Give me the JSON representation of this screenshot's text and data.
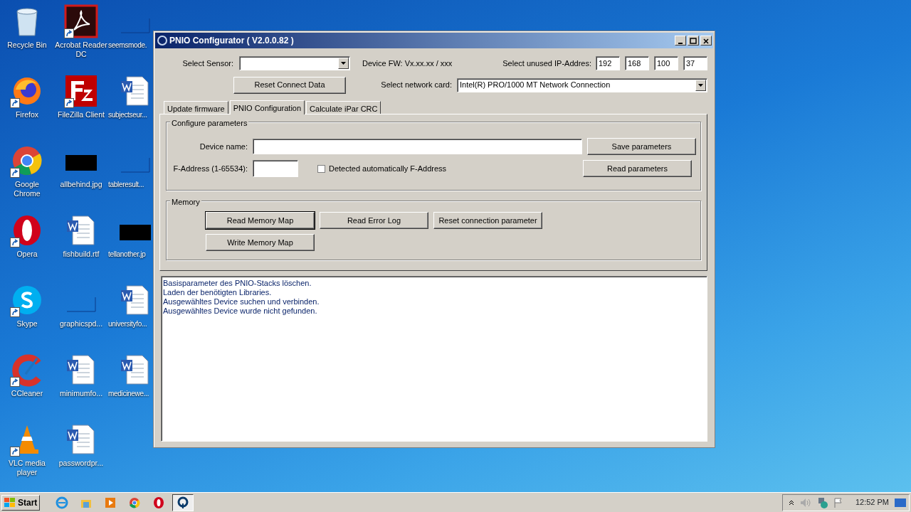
{
  "desktop_icons": [
    {
      "label": "Recycle Bin",
      "kind": "recycle",
      "shortcut": false
    },
    {
      "label": "Firefox",
      "kind": "firefox",
      "shortcut": true
    },
    {
      "label": "Google Chrome",
      "kind": "chrome",
      "shortcut": true
    },
    {
      "label": "Opera",
      "kind": "opera",
      "shortcut": true
    },
    {
      "label": "Skype",
      "kind": "skype",
      "shortcut": true
    },
    {
      "label": "CCleaner",
      "kind": "ccleaner",
      "shortcut": true
    },
    {
      "label": "VLC media player",
      "kind": "vlc",
      "shortcut": true
    },
    {
      "label": "Acrobat Reader DC",
      "kind": "acrobat",
      "shortcut": true
    },
    {
      "label": "FileZilla Client",
      "kind": "filezilla",
      "shortcut": true
    },
    {
      "label": "allbehind.jpg",
      "kind": "dark-image",
      "shortcut": false
    },
    {
      "label": "fishbuild.rtf",
      "kind": "word",
      "shortcut": false
    },
    {
      "label": "graphicspd...",
      "kind": "blank",
      "shortcut": false
    },
    {
      "label": "minimumfo...",
      "kind": "word",
      "shortcut": false
    },
    {
      "label": "passwordpr...",
      "kind": "word",
      "shortcut": false
    },
    {
      "label": "seemsmode.",
      "kind": "blank",
      "shortcut": false
    },
    {
      "label": "subjectseur...",
      "kind": "word",
      "shortcut": false
    },
    {
      "label": "tableresult...",
      "kind": "blank",
      "shortcut": false
    },
    {
      "label": "tellanother.jp",
      "kind": "dark-image",
      "shortcut": false
    },
    {
      "label": "universityfo...",
      "kind": "word",
      "shortcut": false
    },
    {
      "label": "medicinewe...",
      "kind": "word",
      "shortcut": false
    }
  ],
  "window": {
    "title": "PNIO Configurator ( V2.0.0.82 )",
    "select_sensor": {
      "label": "Select Sensor:"
    },
    "device_fw": "Device FW: Vx.xx.xx / xxx",
    "ip_address": {
      "label": "Select unused IP-Addres:",
      "octets": [
        "192",
        "168",
        "100",
        "37"
      ]
    },
    "reset_button": "Reset Connect Data",
    "network_card": {
      "label": "Select network card:",
      "value": "Intel(R) PRO/1000 MT Network Connection"
    },
    "tabs": [
      {
        "label": "Update firmware",
        "selected": false
      },
      {
        "label": "PNIO Configuration",
        "selected": true
      },
      {
        "label": "Calculate iPar CRC",
        "selected": false
      }
    ],
    "configure_group": {
      "title": "Configure parameters",
      "device_name_label": "Device name:",
      "f_address_label": "F-Address (1-65534):",
      "auto_checkbox": {
        "label": "Detected automatically F-Address",
        "checked": false
      },
      "buttons": [
        "Save parameters",
        "Read parameters"
      ]
    },
    "memory_group": {
      "title": "Memory",
      "buttons": [
        {
          "label": "Read Memory Map",
          "focused": true
        },
        {
          "label": "Read Error Log",
          "focused": false
        },
        {
          "label": "Reset connection parameter",
          "focused": false
        },
        {
          "label": "Write Memory Map",
          "focused": false
        }
      ]
    },
    "log": [
      "Basisparameter des PNIO-Stacks löschen.",
      "Laden der benötigten Libraries.",
      "Ausgewähltes Device suchen und verbinden.",
      "Ausgewähltes Device wurde nicht gefunden."
    ]
  },
  "taskbar": {
    "start": "Start",
    "apps": [
      {
        "kind": "ie",
        "active": false
      },
      {
        "kind": "explorer",
        "active": false
      },
      {
        "kind": "media",
        "active": false
      },
      {
        "kind": "chrome",
        "active": false
      },
      {
        "kind": "opera",
        "active": false
      },
      {
        "kind": "pnio",
        "active": true
      }
    ],
    "clock": "12:52 PM"
  }
}
